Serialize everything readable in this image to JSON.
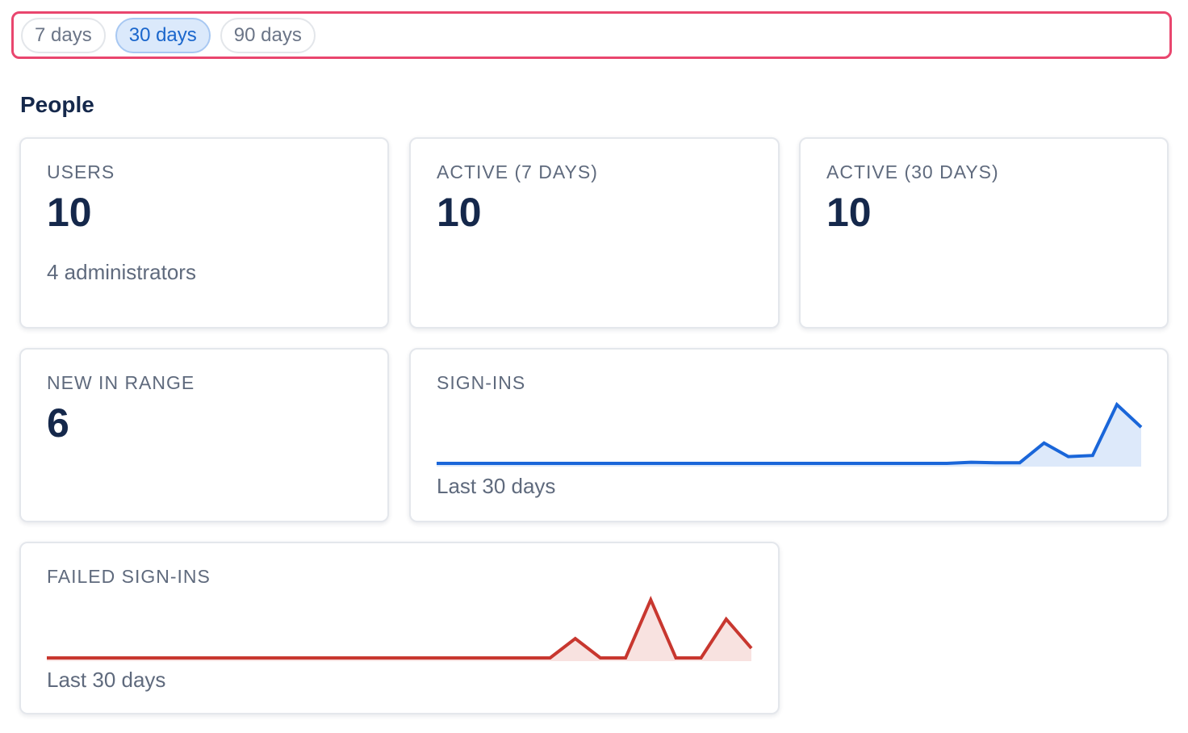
{
  "range_selector": {
    "options": [
      "7 days",
      "30 days",
      "90 days"
    ],
    "selected": "30 days"
  },
  "section": {
    "title": "People"
  },
  "cards": {
    "users": {
      "label": "USERS",
      "value": "10",
      "sub": "4 administrators"
    },
    "active7": {
      "label": "ACTIVE (7 DAYS)",
      "value": "10"
    },
    "active30": {
      "label": "ACTIVE (30 DAYS)",
      "value": "10"
    },
    "new_in_range": {
      "label": "NEW IN RANGE",
      "value": "6"
    },
    "signins": {
      "label": "SIGN-INS",
      "caption": "Last 30 days",
      "color": "#1a66d9",
      "fill": "#dde9fa",
      "series": [
        0,
        0,
        0,
        0,
        0,
        0,
        0,
        0,
        0,
        0,
        0,
        0,
        0,
        0,
        0,
        0,
        0,
        0,
        0,
        0,
        0,
        0,
        0.05,
        0.03,
        0.03,
        0.9,
        0.3,
        0.35,
        2.6,
        1.6
      ]
    },
    "failed_signins": {
      "label": "FAILED SIGN-INS",
      "caption": "Last 30 days",
      "color": "#c8372f",
      "fill": "#f8e2e0",
      "series": [
        0,
        0,
        0,
        0,
        0,
        0,
        0,
        0,
        0,
        0,
        0,
        0,
        0,
        0,
        0,
        0,
        0,
        0,
        0,
        0,
        0,
        1,
        0,
        0,
        3,
        0,
        0,
        2,
        0.5
      ]
    }
  }
}
